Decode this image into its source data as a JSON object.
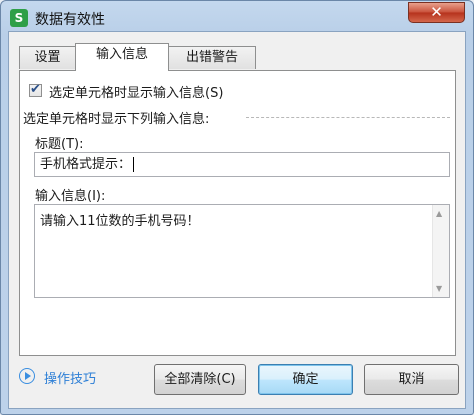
{
  "dialog": {
    "title": "数据有效性",
    "app_icon_glyph": "S",
    "close_glyph": "✕"
  },
  "tabs": [
    {
      "label": "设置",
      "active": false
    },
    {
      "label": "输入信息",
      "active": true
    },
    {
      "label": "出错警告",
      "active": false
    }
  ],
  "input_info": {
    "show_checkbox_label": "选定单元格时显示输入信息(S)",
    "show_checked": true,
    "section_label": "选定单元格时显示下列输入信息:",
    "title_label": "标题(T):",
    "title_value": "手机格式提示：",
    "message_label": "输入信息(I):",
    "message_value": "请输入11位数的手机号码！"
  },
  "footer": {
    "tips_label": "操作技巧",
    "clear_all_label": "全部清除(C)",
    "ok_label": "确定",
    "cancel_label": "取消"
  },
  "colors": {
    "accent": "#2d7fd6",
    "app_icon": "#2e9f48",
    "close": "#c8503a"
  }
}
